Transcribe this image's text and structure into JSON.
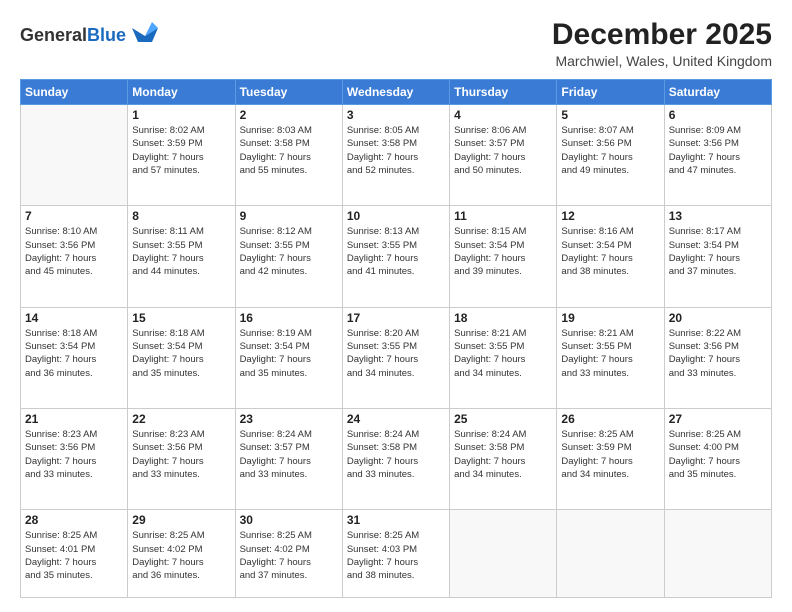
{
  "header": {
    "logo": {
      "line1": "General",
      "line2": "Blue"
    },
    "title": "December 2025",
    "location": "Marchwiel, Wales, United Kingdom"
  },
  "days_of_week": [
    "Sunday",
    "Monday",
    "Tuesday",
    "Wednesday",
    "Thursday",
    "Friday",
    "Saturday"
  ],
  "weeks": [
    [
      {
        "day": "",
        "info": ""
      },
      {
        "day": "1",
        "info": "Sunrise: 8:02 AM\nSunset: 3:59 PM\nDaylight: 7 hours\nand 57 minutes."
      },
      {
        "day": "2",
        "info": "Sunrise: 8:03 AM\nSunset: 3:58 PM\nDaylight: 7 hours\nand 55 minutes."
      },
      {
        "day": "3",
        "info": "Sunrise: 8:05 AM\nSunset: 3:58 PM\nDaylight: 7 hours\nand 52 minutes."
      },
      {
        "day": "4",
        "info": "Sunrise: 8:06 AM\nSunset: 3:57 PM\nDaylight: 7 hours\nand 50 minutes."
      },
      {
        "day": "5",
        "info": "Sunrise: 8:07 AM\nSunset: 3:56 PM\nDaylight: 7 hours\nand 49 minutes."
      },
      {
        "day": "6",
        "info": "Sunrise: 8:09 AM\nSunset: 3:56 PM\nDaylight: 7 hours\nand 47 minutes."
      }
    ],
    [
      {
        "day": "7",
        "info": "Sunrise: 8:10 AM\nSunset: 3:56 PM\nDaylight: 7 hours\nand 45 minutes."
      },
      {
        "day": "8",
        "info": "Sunrise: 8:11 AM\nSunset: 3:55 PM\nDaylight: 7 hours\nand 44 minutes."
      },
      {
        "day": "9",
        "info": "Sunrise: 8:12 AM\nSunset: 3:55 PM\nDaylight: 7 hours\nand 42 minutes."
      },
      {
        "day": "10",
        "info": "Sunrise: 8:13 AM\nSunset: 3:55 PM\nDaylight: 7 hours\nand 41 minutes."
      },
      {
        "day": "11",
        "info": "Sunrise: 8:15 AM\nSunset: 3:54 PM\nDaylight: 7 hours\nand 39 minutes."
      },
      {
        "day": "12",
        "info": "Sunrise: 8:16 AM\nSunset: 3:54 PM\nDaylight: 7 hours\nand 38 minutes."
      },
      {
        "day": "13",
        "info": "Sunrise: 8:17 AM\nSunset: 3:54 PM\nDaylight: 7 hours\nand 37 minutes."
      }
    ],
    [
      {
        "day": "14",
        "info": "Sunrise: 8:18 AM\nSunset: 3:54 PM\nDaylight: 7 hours\nand 36 minutes."
      },
      {
        "day": "15",
        "info": "Sunrise: 8:18 AM\nSunset: 3:54 PM\nDaylight: 7 hours\nand 35 minutes."
      },
      {
        "day": "16",
        "info": "Sunrise: 8:19 AM\nSunset: 3:54 PM\nDaylight: 7 hours\nand 35 minutes."
      },
      {
        "day": "17",
        "info": "Sunrise: 8:20 AM\nSunset: 3:55 PM\nDaylight: 7 hours\nand 34 minutes."
      },
      {
        "day": "18",
        "info": "Sunrise: 8:21 AM\nSunset: 3:55 PM\nDaylight: 7 hours\nand 34 minutes."
      },
      {
        "day": "19",
        "info": "Sunrise: 8:21 AM\nSunset: 3:55 PM\nDaylight: 7 hours\nand 33 minutes."
      },
      {
        "day": "20",
        "info": "Sunrise: 8:22 AM\nSunset: 3:56 PM\nDaylight: 7 hours\nand 33 minutes."
      }
    ],
    [
      {
        "day": "21",
        "info": "Sunrise: 8:23 AM\nSunset: 3:56 PM\nDaylight: 7 hours\nand 33 minutes."
      },
      {
        "day": "22",
        "info": "Sunrise: 8:23 AM\nSunset: 3:56 PM\nDaylight: 7 hours\nand 33 minutes."
      },
      {
        "day": "23",
        "info": "Sunrise: 8:24 AM\nSunset: 3:57 PM\nDaylight: 7 hours\nand 33 minutes."
      },
      {
        "day": "24",
        "info": "Sunrise: 8:24 AM\nSunset: 3:58 PM\nDaylight: 7 hours\nand 33 minutes."
      },
      {
        "day": "25",
        "info": "Sunrise: 8:24 AM\nSunset: 3:58 PM\nDaylight: 7 hours\nand 34 minutes."
      },
      {
        "day": "26",
        "info": "Sunrise: 8:25 AM\nSunset: 3:59 PM\nDaylight: 7 hours\nand 34 minutes."
      },
      {
        "day": "27",
        "info": "Sunrise: 8:25 AM\nSunset: 4:00 PM\nDaylight: 7 hours\nand 35 minutes."
      }
    ],
    [
      {
        "day": "28",
        "info": "Sunrise: 8:25 AM\nSunset: 4:01 PM\nDaylight: 7 hours\nand 35 minutes."
      },
      {
        "day": "29",
        "info": "Sunrise: 8:25 AM\nSunset: 4:02 PM\nDaylight: 7 hours\nand 36 minutes."
      },
      {
        "day": "30",
        "info": "Sunrise: 8:25 AM\nSunset: 4:02 PM\nDaylight: 7 hours\nand 37 minutes."
      },
      {
        "day": "31",
        "info": "Sunrise: 8:25 AM\nSunset: 4:03 PM\nDaylight: 7 hours\nand 38 minutes."
      },
      {
        "day": "",
        "info": ""
      },
      {
        "day": "",
        "info": ""
      },
      {
        "day": "",
        "info": ""
      }
    ]
  ]
}
